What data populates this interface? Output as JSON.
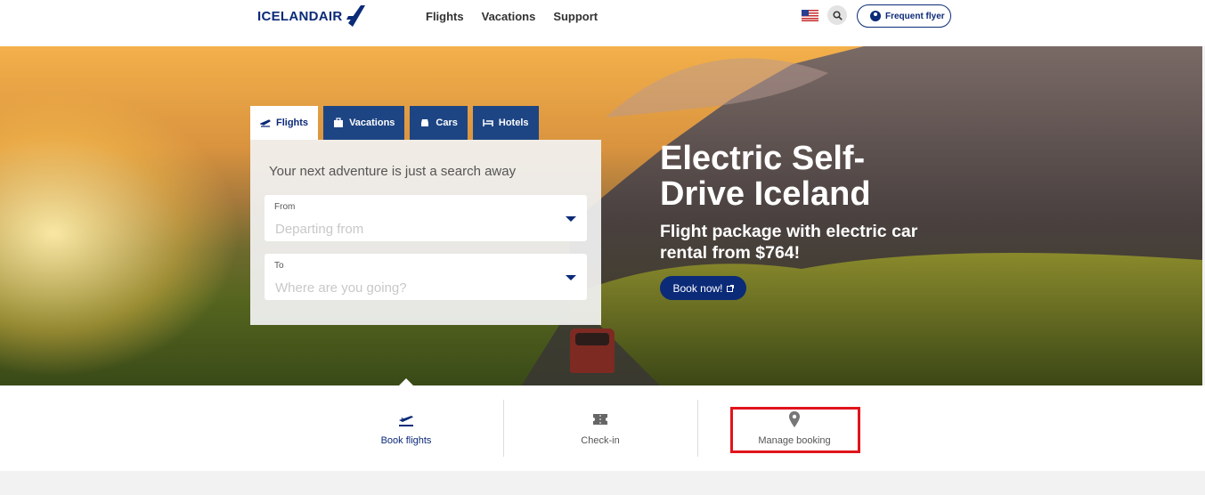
{
  "header": {
    "brand": "ICELANDAIR",
    "nav": [
      "Flights",
      "Vacations",
      "Support"
    ],
    "flag_icon": "us-flag-icon",
    "search_icon": "search-icon",
    "frequent_flyer_label": "Frequent flyer"
  },
  "search": {
    "tabs": [
      {
        "label": "Flights",
        "icon": "plane-icon",
        "active": true
      },
      {
        "label": "Vacations",
        "icon": "suitcase-icon",
        "active": false
      },
      {
        "label": "Cars",
        "icon": "car-icon",
        "active": false
      },
      {
        "label": "Hotels",
        "icon": "bed-icon",
        "active": false
      }
    ],
    "title": "Your next adventure is just a search away",
    "from_label": "From",
    "from_placeholder": "Departing from",
    "to_label": "To",
    "to_placeholder": "Where are you going?"
  },
  "hero": {
    "title": "Electric Self-Drive Iceland",
    "subtitle": "Flight package with electric car rental from $764!",
    "cta_label": "Book now!"
  },
  "quick_links": [
    {
      "label": "Book flights",
      "icon": "plane-departure-icon",
      "color": "#0b2a78"
    },
    {
      "label": "Check-in",
      "icon": "ticket-icon",
      "color": "#555555"
    },
    {
      "label": "Manage booking",
      "icon": "location-pin-icon",
      "color": "#555555"
    }
  ],
  "colors": {
    "brand": "#0b2a78",
    "tab_inactive": "#1d4584",
    "highlight": "#e1141c"
  }
}
